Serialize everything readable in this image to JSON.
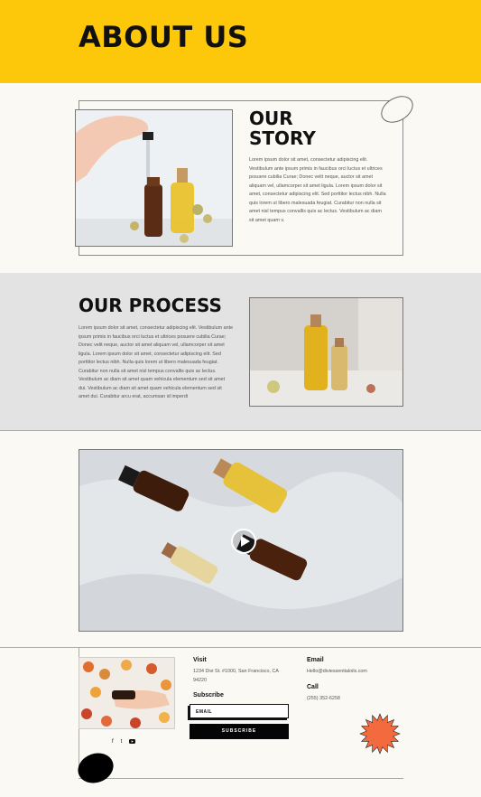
{
  "hero": {
    "title": "ABOUT US",
    "bg": "#fdc70a"
  },
  "story": {
    "title": "OUR\nSTORY",
    "body": "Lorem ipsum dolor sit amet, consectetur adipiscing elit. Vestibulum ante ipsum primis in faucibus orci luctus et ultrices posuere cubilia Curae; Donec velit neque, auctor sit amet aliquam vel, ullamcorper sit amet ligula. Lorem ipsum dolor sit amet, consectetur adipiscing elit. Sed porttitor lectus nibh. Nulla quis lorem ut libero malesuada feugiat. Curabitur non nulla sit amet nisl tempus convallis quis ac lectus. Vestibulum ac diam sit amet quam v."
  },
  "process": {
    "title": "OUR PROCESS",
    "body": "Lorem ipsum dolor sit amet, consectetur adipiscing elit. Vestibulum ante ipsum primis in faucibus orci luctus et ultrices posuere cubilia Curae; Donec velit neque, auctor sit amet aliquam vel, ullamcorper sit amet ligula. Lorem ipsum dolor sit amet, consectetur adipiscing elit. Sed porttitor lectus nibh. Nulla quis lorem ut libero malesuada feugiat. Curabitur non nulla sit amet nisl tempus convallis quis ac lectus. Vestibulum ac diam sit amet quam vehicula elementum sed sit amet dui. Vestibulum ac diam sit amet quam vehicula elementum sed sit amet dui. Curabitur arcu erat, accumsan id imperdi"
  },
  "footer": {
    "visit_heading": "Visit",
    "address": "1234 Divi St. #1000, San Francisco, CA 94220",
    "subscribe_heading": "Subscribe",
    "email_placeholder": "EMAIL",
    "subscribe_button": "SUBSCRIBE",
    "email_heading": "Email",
    "email_value": "Hello@diviessentialoils.com",
    "call_heading": "Call",
    "phone": "(255) 352-6258",
    "socials": [
      "f",
      "t",
      "y"
    ],
    "accent_color": "#f26a3d"
  }
}
